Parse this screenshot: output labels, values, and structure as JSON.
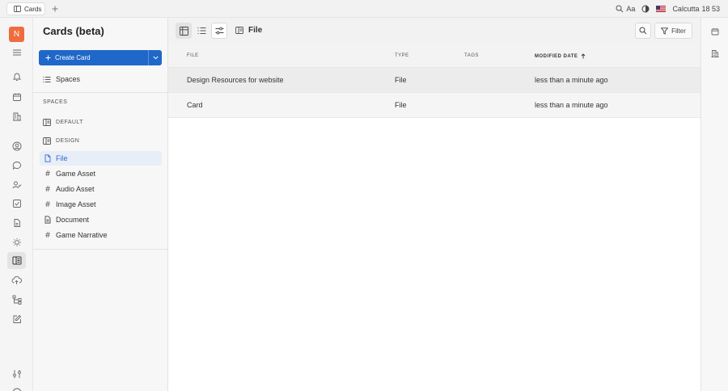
{
  "topbar": {
    "tab_label": "Cards",
    "text_size_label": "Aa",
    "city": "Calcutta",
    "time": "18 53"
  },
  "rail": {
    "avatar_letter": "N"
  },
  "sidebar": {
    "title": "Cards (beta)",
    "create_label": "Create Card",
    "spaces_link": "Spaces",
    "section_label": "SPACES",
    "groups": [
      "DEFAULT",
      "DESIGN"
    ],
    "items": [
      {
        "label": "File"
      },
      {
        "label": "Game Asset"
      },
      {
        "label": "Audio Asset"
      },
      {
        "label": "Image Asset"
      },
      {
        "label": "Document"
      },
      {
        "label": "Game Narrative"
      }
    ]
  },
  "main": {
    "title": "File",
    "filter_label": "Filter",
    "columns": [
      "FILE",
      "TYPE",
      "TAGS",
      "MODIFIED DATE"
    ],
    "rows": [
      {
        "file": "Design Resources for website",
        "type": "File",
        "tags": "",
        "modified": "less than a minute ago"
      },
      {
        "file": "Card",
        "type": "File",
        "tags": "",
        "modified": "less than a minute ago"
      }
    ]
  },
  "colors": {
    "accent": "#1f68c9",
    "avatar": "#ef6c3e",
    "active_item": "#2e6bd0"
  }
}
